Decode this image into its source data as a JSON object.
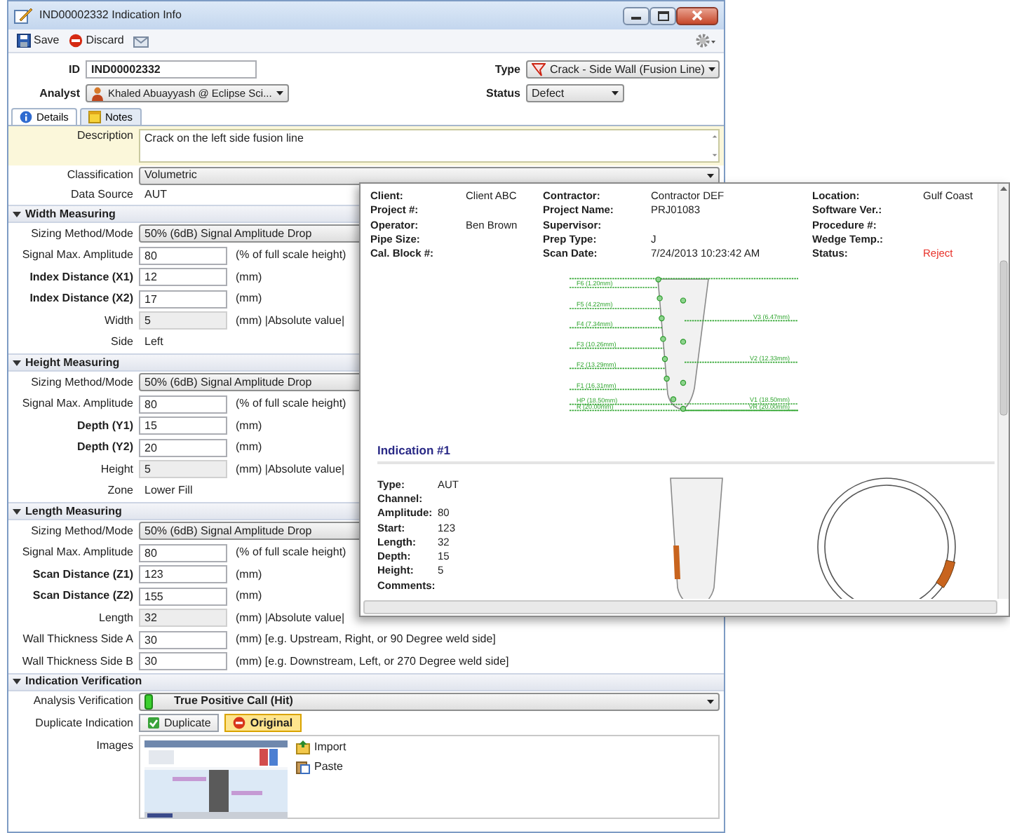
{
  "window": {
    "title": "IND00002332 Indication Info"
  },
  "toolbar": {
    "buttons": [
      {
        "label": "Save",
        "kind": "save"
      },
      {
        "label": "Discard",
        "kind": "discard"
      }
    ]
  },
  "header": {
    "id": {
      "label": "ID",
      "value": "IND00002332"
    },
    "type": {
      "label": "Type",
      "value": "Crack - Side Wall (Fusion Line)"
    },
    "analyst": {
      "label": "Analyst",
      "value": "Khaled Abuayyash @ Eclipse Sci..."
    },
    "status": {
      "label": "Status",
      "value": "Defect"
    }
  },
  "tabs": [
    {
      "label": "Details",
      "kind": "info",
      "selected": true
    },
    {
      "label": "Notes",
      "kind": "note",
      "selected": false
    }
  ],
  "details": {
    "description": {
      "label": "Description",
      "value": "Crack on the left side fusion line"
    },
    "classification": {
      "label": "Classification",
      "value": "Volumetric"
    },
    "data_source": {
      "label": "Data Source",
      "value": "AUT"
    }
  },
  "sections": [
    {
      "title": "Width Measuring",
      "expanded": true,
      "rows": [
        {
          "kind": "select",
          "label": "Sizing Method/Mode",
          "value": "50% (6dB) Signal Amplitude Drop",
          "emphasized": false
        },
        {
          "kind": "input",
          "label": "Signal Max. Amplitude",
          "value": "80",
          "unit": "(% of full scale height)",
          "emphasized": false
        },
        {
          "kind": "input",
          "label": "Index Distance (X1)",
          "value": "12",
          "unit": "(mm)",
          "emphasized": true
        },
        {
          "kind": "input",
          "label": "Index Distance (X2)",
          "value": "17",
          "unit": "(mm)",
          "emphasized": true
        },
        {
          "kind": "readonly",
          "label": "Width",
          "value": "5",
          "unit": "(mm) |Absolute value|",
          "emphasized": false
        },
        {
          "kind": "text",
          "label": "Side",
          "value": "Left",
          "emphasized": false
        }
      ]
    },
    {
      "title": "Height Measuring",
      "expanded": true,
      "rows": [
        {
          "kind": "select",
          "label": "Sizing Method/Mode",
          "value": "50% (6dB) Signal Amplitude Drop",
          "emphasized": false
        },
        {
          "kind": "input",
          "label": "Signal Max. Amplitude",
          "value": "80",
          "unit": "(% of full scale height)",
          "emphasized": false
        },
        {
          "kind": "input",
          "label": "Depth (Y1)",
          "value": "15",
          "unit": "(mm)",
          "emphasized": true
        },
        {
          "kind": "input",
          "label": "Depth (Y2)",
          "value": "20",
          "unit": "(mm)",
          "emphasized": true
        },
        {
          "kind": "readonly",
          "label": "Height",
          "value": "5",
          "unit": "(mm) |Absolute value|",
          "emphasized": false
        },
        {
          "kind": "text",
          "label": "Zone",
          "value": "Lower Fill",
          "emphasized": false
        }
      ]
    },
    {
      "title": "Length Measuring",
      "expanded": true,
      "rows": [
        {
          "kind": "select",
          "label": "Sizing Method/Mode",
          "value": "50% (6dB) Signal Amplitude Drop",
          "emphasized": false
        },
        {
          "kind": "input",
          "label": "Signal Max. Amplitude",
          "value": "80",
          "unit": "(% of full scale height)",
          "emphasized": false
        },
        {
          "kind": "input",
          "label": "Scan Distance (Z1)",
          "value": "123",
          "unit": "(mm)",
          "emphasized": true
        },
        {
          "kind": "input",
          "label": "Scan Distance (Z2)",
          "value": "155",
          "unit": "(mm)",
          "emphasized": true
        },
        {
          "kind": "readonly",
          "label": "Length",
          "value": "32",
          "unit": "(mm) |Absolute value|",
          "emphasized": false
        },
        {
          "kind": "input",
          "label": "Wall Thickness Side A",
          "value": "30",
          "unit": "(mm) [e.g. Upstream, Right, or 90 Degree weld side]",
          "emphasized": false
        },
        {
          "kind": "input",
          "label": "Wall Thickness Side B",
          "value": "30",
          "unit": "(mm) [e.g. Downstream, Left, or 270 Degree weld side]",
          "emphasized": false
        }
      ]
    },
    {
      "title": "Indication Verification",
      "expanded": true,
      "rows": [
        {
          "kind": "verdict",
          "label": "Analysis Verification",
          "value": "True Positive Call (Hit)",
          "emphasized": false
        },
        {
          "kind": "toggle",
          "label": "Duplicate Indication",
          "emphasized": false,
          "options": [
            {
              "label": "Duplicate",
              "kind": "check",
              "selected": false
            },
            {
              "label": "Original",
              "kind": "stop",
              "selected": true
            }
          ]
        },
        {
          "kind": "images",
          "label": "Images",
          "emphasized": false,
          "actions": [
            {
              "label": "Import",
              "kind": "import"
            },
            {
              "label": "Paste",
              "kind": "paste"
            }
          ]
        }
      ]
    }
  ],
  "report": {
    "info_rows": [
      [
        {
          "label": "Client:",
          "value": "Client ABC"
        },
        {
          "label": "Contractor:",
          "value": "Contractor DEF"
        },
        {
          "label": "Location:",
          "value": "Gulf Coast",
          "alert": false
        }
      ],
      [
        {
          "label": "Project #:"
        },
        {
          "label": "Project Name:",
          "value": "PRJ01083"
        },
        {
          "label": "Software Ver.:"
        }
      ],
      [
        {
          "label": "Operator:",
          "value": "Ben Brown"
        },
        {
          "label": "Supervisor:"
        },
        {
          "label": "Procedure #:"
        }
      ],
      [
        {
          "label": "Pipe Size:"
        },
        {
          "label": "Prep Type:",
          "value": "J"
        },
        {
          "label": "Wedge Temp.:"
        }
      ],
      [
        {
          "label": "Cal. Block #:"
        },
        {
          "label": "Scan Date:",
          "value": "7/24/2013 10:23:42 AM"
        },
        {
          "label": "Status:",
          "value": "Reject",
          "alert": true
        }
      ]
    ],
    "profile": {
      "left_labels": [
        "F6 (1.20mm)",
        "F5 (4.22mm)",
        "F4 (7.34mm)",
        "F3 (10.26mm)",
        "F2 (13.29mm)",
        "F1 (16.31mm)",
        "HP (18.50mm)",
        "R (20.00mm)"
      ],
      "right_labels": [
        "V3 (6.47mm)",
        "V2 (12.33mm)",
        "V1 (18.50mm)",
        "VR (20.00mm)"
      ]
    },
    "indication": {
      "title": "Indication #1",
      "fields": [
        {
          "label": "Type:",
          "value": "AUT"
        },
        {
          "label": "Channel:"
        },
        {
          "label": "Amplitude:",
          "value": "80"
        },
        {
          "label": "Start:",
          "value": "123"
        },
        {
          "label": "Length:",
          "value": "32"
        },
        {
          "label": "Depth:",
          "value": "15"
        },
        {
          "label": "Height:",
          "value": "5"
        },
        {
          "label": "Comments:"
        }
      ]
    }
  }
}
